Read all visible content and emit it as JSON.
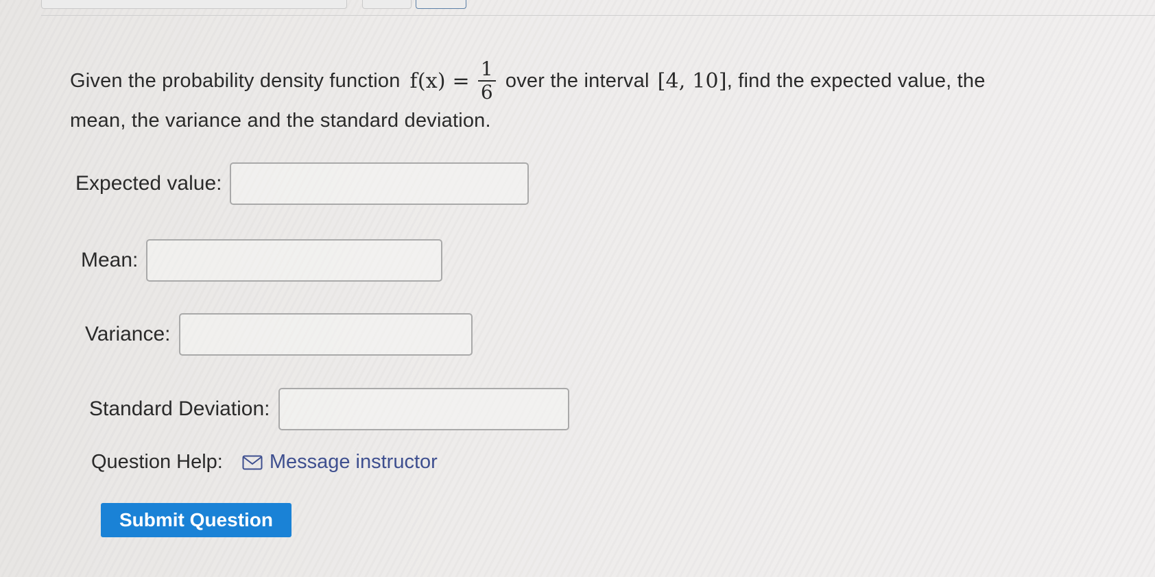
{
  "question": {
    "intro": "Given the probability density function",
    "function_lhs": "f(x) =",
    "fraction_numerator": "1",
    "fraction_denominator": "6",
    "over_text": "over the interval",
    "interval": "[4, 10]",
    "tail_text": ", find the expected value, the",
    "line2": "mean, the variance and the standard deviation."
  },
  "fields": [
    {
      "label": "Expected value:",
      "value": "",
      "placeholder": ""
    },
    {
      "label": "Mean:",
      "value": "",
      "placeholder": ""
    },
    {
      "label": "Variance:",
      "value": "",
      "placeholder": ""
    },
    {
      "label": "Standard Deviation:",
      "value": "",
      "placeholder": ""
    }
  ],
  "help": {
    "label": "Question Help:",
    "link_icon": "mail-icon",
    "link_text": "Message instructor"
  },
  "submit": {
    "label": "Submit Question",
    "color": "#1a82d6"
  }
}
